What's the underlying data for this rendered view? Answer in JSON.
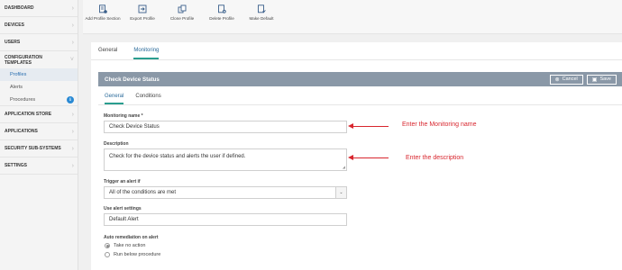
{
  "sidebar": {
    "items": [
      {
        "label": "DASHBOARD"
      },
      {
        "label": "DEVICES"
      },
      {
        "label": "USERS"
      },
      {
        "label": "CONFIGURATION TEMPLATES"
      }
    ],
    "sub_items": [
      {
        "label": "Profiles"
      },
      {
        "label": "Alerts"
      },
      {
        "label": "Procedures"
      }
    ],
    "items_bottom": [
      {
        "label": "APPLICATION STORE"
      },
      {
        "label": "APPLICATIONS"
      },
      {
        "label": "SECURITY SUB-SYSTEMS"
      },
      {
        "label": "SETTINGS"
      }
    ]
  },
  "toolbar": {
    "add_profile_section": "Add Profile Section",
    "export_profile": "Export Profile",
    "clone_profile": "Clone Profile",
    "delete_profile": "Delete Profile",
    "make_default": "Make Default"
  },
  "top_tabs": {
    "general": "General",
    "monitoring": "Monitoring"
  },
  "panel": {
    "title": "Check Device Status",
    "cancel_label": "Cancel",
    "save_label": "Save"
  },
  "inner_tabs": {
    "general": "General",
    "conditions": "Conditions"
  },
  "form": {
    "monitoring_name_label": "Monitoring name *",
    "monitoring_name_value": "Check Device Status",
    "description_label": "Description",
    "description_value": "Check for the device status and alerts the user if defined.",
    "trigger_label": "Trigger an alert if",
    "trigger_value": "All of the conditions are met",
    "alert_settings_label": "Use alert settings",
    "alert_settings_value": "Default Alert",
    "auto_remediation_label": "Auto remediation on alert",
    "option_no_action": "Take no action",
    "option_run_procedure": "Run below procedure"
  },
  "annotations": {
    "name_note": "Enter the Monitoring name",
    "description_note": "Enter the description"
  },
  "colors": {
    "annotation": "#d8262e",
    "header": "#8a98a7",
    "accent": "#2a9d8f"
  }
}
